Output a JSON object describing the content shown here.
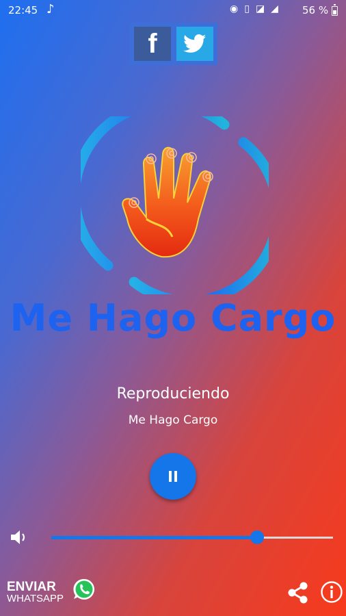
{
  "status_bar": {
    "time": "22:45",
    "music_icon": "music-note-icon",
    "icons": [
      "hotspot-icon",
      "vibrate-icon",
      "no-sim-icon",
      "signal-icon"
    ],
    "battery_percent": "56 %"
  },
  "social": {
    "facebook_icon": "facebook-icon",
    "facebook_glyph": "f",
    "twitter_icon": "twitter-icon"
  },
  "logo": {
    "icon": "hand-logo-icon",
    "name": "Me Hago Cargo"
  },
  "player": {
    "state_label": "Reproduciendo",
    "station_name": "Me Hago Cargo",
    "control_icon": "pause-icon",
    "volume": 0.73
  },
  "footer": {
    "whatsapp_title": "ENVIAR",
    "whatsapp_subtitle": "WHATSAPP",
    "whatsapp_icon": "whatsapp-icon",
    "share_icon": "share-icon",
    "info_icon": "info-icon"
  },
  "colors": {
    "accent": "#1476e8",
    "brand_text": "#1e62f0",
    "gradient_top": "#1e6ff0",
    "gradient_bottom": "#f73a1c",
    "facebook": "#3b5b9a",
    "twitter": "#28a8e6"
  }
}
